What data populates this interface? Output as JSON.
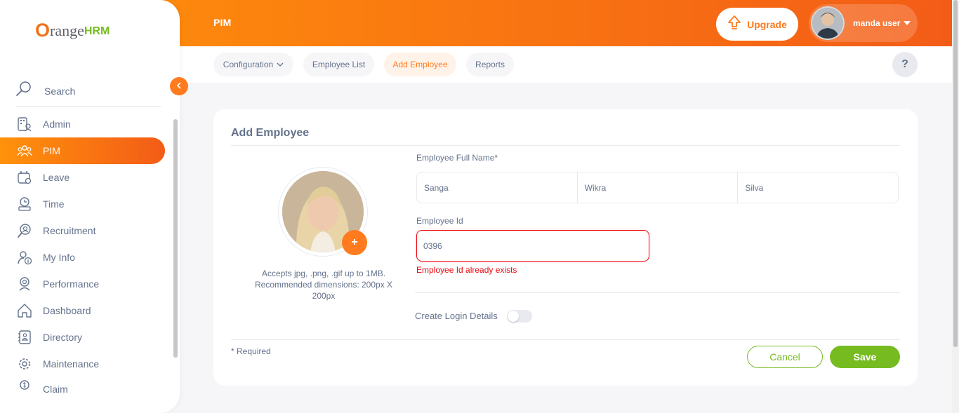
{
  "header": {
    "module_title": "PIM",
    "upgrade_label": "Upgrade",
    "user_name": "manda user"
  },
  "subnav": {
    "tabs": [
      {
        "label": "Configuration",
        "has_dropdown": true
      },
      {
        "label": "Employee List"
      },
      {
        "label": "Add Employee",
        "active": true
      },
      {
        "label": "Reports"
      }
    ],
    "help_label": "?"
  },
  "sidebar": {
    "logo": {
      "o": "O",
      "range": "range",
      "hrm": "HRM"
    },
    "search_label": "Search",
    "items": [
      {
        "label": "Admin",
        "icon": "admin-icon"
      },
      {
        "label": "PIM",
        "icon": "pim-icon",
        "active": true
      },
      {
        "label": "Leave",
        "icon": "leave-icon"
      },
      {
        "label": "Time",
        "icon": "time-icon"
      },
      {
        "label": "Recruitment",
        "icon": "recruitment-icon"
      },
      {
        "label": "My Info",
        "icon": "my-info-icon"
      },
      {
        "label": "Performance",
        "icon": "performance-icon"
      },
      {
        "label": "Dashboard",
        "icon": "dashboard-icon"
      },
      {
        "label": "Directory",
        "icon": "directory-icon"
      },
      {
        "label": "Maintenance",
        "icon": "maintenance-icon"
      },
      {
        "label": "Claim",
        "icon": "claim-icon"
      }
    ]
  },
  "form": {
    "title": "Add Employee",
    "photo_hint": "Accepts jpg, .png, .gif up to 1MB. Recommended dimensions: 200px X 200px",
    "full_name_label": "Employee Full Name*",
    "first_name": "Sanga",
    "middle_name": "Wikra",
    "last_name": "Silva",
    "employee_id_label": "Employee Id",
    "employee_id": "0396",
    "employee_id_error": "Employee Id already exists",
    "create_login_label": "Create Login Details",
    "create_login_enabled": false,
    "required_note": "* Required",
    "cancel_label": "Cancel",
    "save_label": "Save"
  },
  "colors": {
    "accent": "#ff7b1d",
    "success": "#76bc21",
    "error": "#eb0910",
    "text": "#64728c"
  }
}
